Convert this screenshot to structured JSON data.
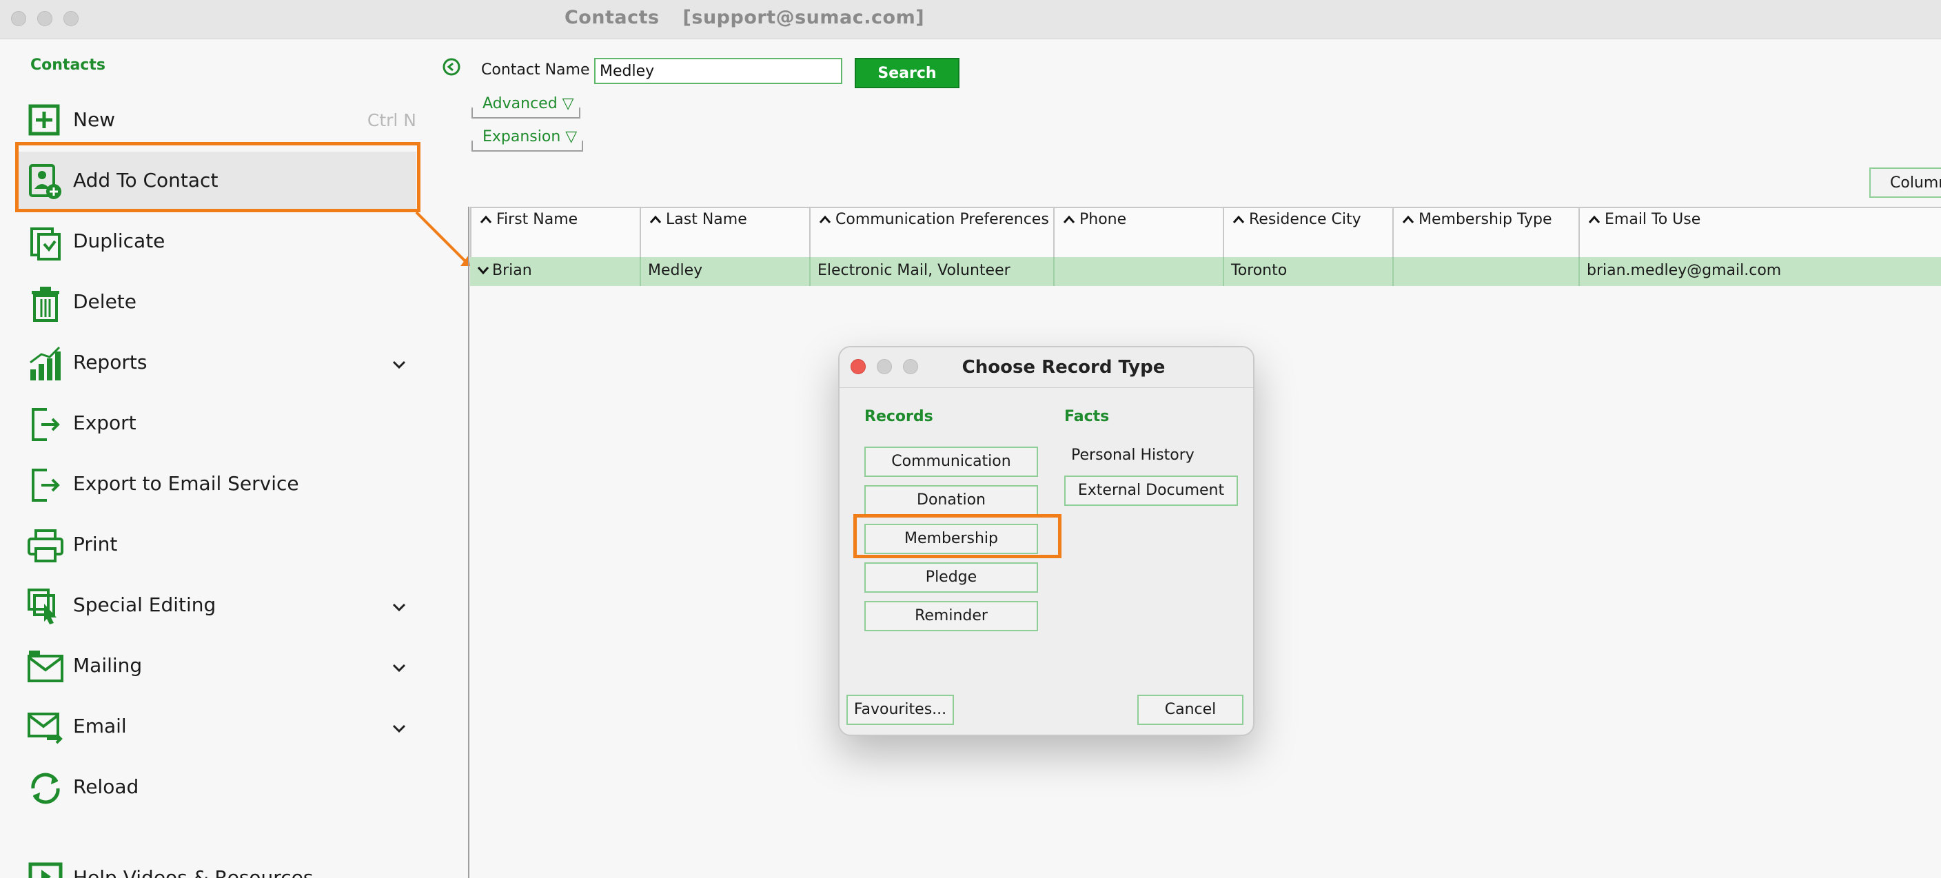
{
  "window": {
    "title": "Contacts",
    "account": "[support@sumac.com]"
  },
  "sidebar": {
    "heading": "Contacts",
    "items": [
      {
        "label": "New",
        "shortcut": "Ctrl N",
        "icon": "plus-square-icon"
      },
      {
        "label": "Add To Contact",
        "icon": "contact-add-icon",
        "selected": true
      },
      {
        "label": "Duplicate",
        "icon": "duplicate-icon"
      },
      {
        "label": "Delete",
        "icon": "trash-icon"
      },
      {
        "label": "Reports",
        "icon": "bar-chart-icon",
        "expandable": true
      },
      {
        "label": "Export",
        "icon": "export-icon"
      },
      {
        "label": "Export to Email Service",
        "icon": "export-icon"
      },
      {
        "label": "Print",
        "icon": "printer-icon"
      },
      {
        "label": "Special Editing",
        "icon": "special-editing-icon",
        "expandable": true
      },
      {
        "label": "Mailing",
        "icon": "envelope-icon",
        "expandable": true
      },
      {
        "label": "Email",
        "icon": "email-icon",
        "expandable": true
      },
      {
        "label": "Reload",
        "icon": "reload-icon"
      },
      {
        "label": "Help Videos & Resources",
        "icon": "video-icon"
      }
    ]
  },
  "search": {
    "label": "Contact Name",
    "value": "Medley",
    "button": "Search",
    "advanced": "Advanced ▽",
    "expansion": "Expansion ▽"
  },
  "columns_button": "Columns",
  "table": {
    "headers": [
      "First Name",
      "Last Name",
      "Communication Preferences",
      "Phone",
      "Residence City",
      "Membership Type",
      "Email To Use"
    ],
    "rows": [
      [
        "Brian",
        "Medley",
        "Electronic Mail, Volunteer",
        "",
        "Toronto",
        "",
        "brian.medley@gmail.com"
      ]
    ]
  },
  "dialog": {
    "title": "Choose Record Type",
    "records_heading": "Records",
    "facts_heading": "Facts",
    "records": [
      "Communication",
      "Donation",
      "Membership",
      "Pledge",
      "Reminder"
    ],
    "facts_static": "Personal History",
    "facts_buttons": [
      "External Document"
    ],
    "favourites": "Favourites...",
    "cancel": "Cancel"
  },
  "colors": {
    "accent_green": "#1e8c2c",
    "button_green": "#14a029",
    "row_highlight": "#c4e4c6",
    "annotation_orange": "#f07d18"
  }
}
